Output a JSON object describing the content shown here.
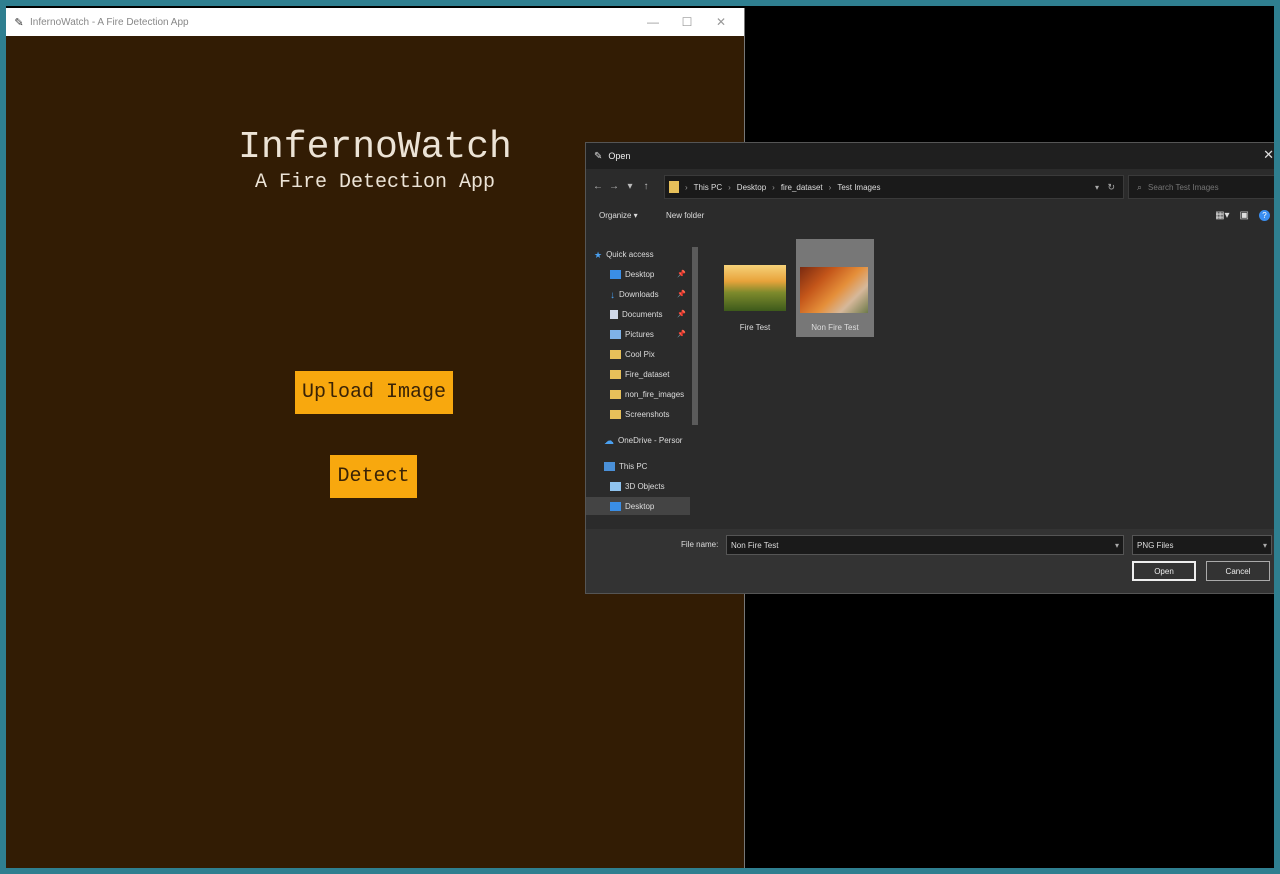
{
  "app_window": {
    "title": "InfernoWatch - A Fire Detection App",
    "heading": "InfernoWatch",
    "subheading": "A Fire Detection App",
    "upload_label": "Upload Image",
    "detect_label": "Detect",
    "colors": {
      "background": "#321c04",
      "button": "#f8a80e",
      "text": "#ece3d6"
    }
  },
  "dialog": {
    "title": "Open",
    "breadcrumb": [
      "This PC",
      "Desktop",
      "fire_dataset",
      "Test Images"
    ],
    "search_placeholder": "Search Test Images",
    "toolbar": {
      "organize": "Organize ▾",
      "new_folder": "New folder"
    },
    "nav": {
      "quick_access": "Quick access",
      "desktop": "Desktop",
      "downloads": "Downloads",
      "documents": "Documents",
      "pictures": "Pictures",
      "cool_pix": "Cool Pix",
      "fire_dataset": "Fire_dataset",
      "non_fire_images": "non_fire_images",
      "screenshots": "Screenshots",
      "onedrive": "OneDrive - Persor",
      "this_pc": "This PC",
      "objects_3d": "3D Objects",
      "desktop2": "Desktop"
    },
    "files": [
      {
        "name": "Fire Test",
        "selected": false
      },
      {
        "name": "Non Fire Test",
        "selected": true
      }
    ],
    "file_name_label": "File name:",
    "file_name_value": "Non Fire Test",
    "file_type": "PNG Files",
    "open_label": "Open",
    "cancel_label": "Cancel"
  }
}
